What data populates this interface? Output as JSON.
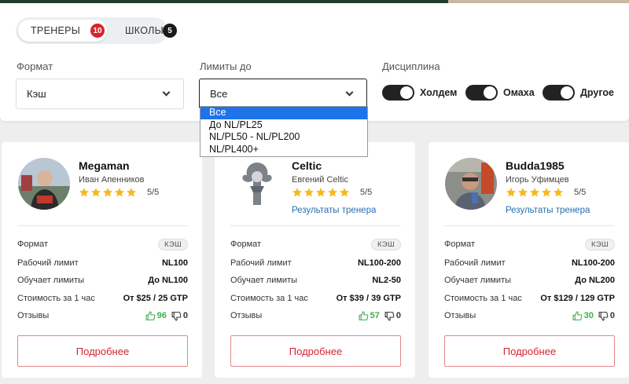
{
  "tabs": [
    {
      "label": "ТРЕНЕРЫ",
      "count": "10"
    },
    {
      "label": "ШКОЛЫ",
      "count": "5"
    }
  ],
  "filters": {
    "format": {
      "label": "Формат",
      "value": "Кэш"
    },
    "limits": {
      "label": "Лимиты до",
      "value": "Все",
      "options": [
        "Все",
        "До NL/PL25",
        "NL/PL50 - NL/PL200",
        "NL/PL400+"
      ],
      "selected_index": 0
    },
    "discipline": {
      "label": "Дисциплина",
      "toggles": [
        {
          "label": "Холдем",
          "on": true
        },
        {
          "label": "Омаха",
          "on": true
        },
        {
          "label": "Другое",
          "on": true
        }
      ]
    }
  },
  "row_labels": {
    "format": "Формат",
    "work_limit": "Рабочий лимит",
    "teaches_limits": "Обучает лимиты",
    "cost": "Стоимость за 1 час",
    "reviews": "Отзывы"
  },
  "results_link_label": "Результаты тренера",
  "more_button_label": "Подробнее",
  "colors": {
    "accent": "#d9232e",
    "link": "#2a6fb0",
    "star": "#f6b81b",
    "positive": "#3fae49",
    "dropdown_selected": "#1e73e8"
  },
  "cards": [
    {
      "name": "Megaman",
      "fullname": "Иван Апенников",
      "stars": 5,
      "rating": "5/5",
      "format": "КЭШ",
      "work_limit": "NL100",
      "teaches_limits": "До NL100",
      "cost": "От $25 / 25 GTP",
      "reviews_up": "96",
      "reviews_down": "0"
    },
    {
      "name": "Celtic",
      "fullname": "Евгений Celtic",
      "stars": 5,
      "rating": "5/5",
      "format": "КЭШ",
      "work_limit": "NL100-200",
      "teaches_limits": "NL2-50",
      "cost": "От $39 / 39 GTP",
      "reviews_up": "57",
      "reviews_down": "0"
    },
    {
      "name": "Budda1985",
      "fullname": "Игорь Уфимцев",
      "stars": 5,
      "rating": "5/5",
      "format": "КЭШ",
      "work_limit": "NL100-200",
      "teaches_limits": "До NL200",
      "cost": "От $129 / 129 GTP",
      "reviews_up": "30",
      "reviews_down": "0"
    }
  ]
}
